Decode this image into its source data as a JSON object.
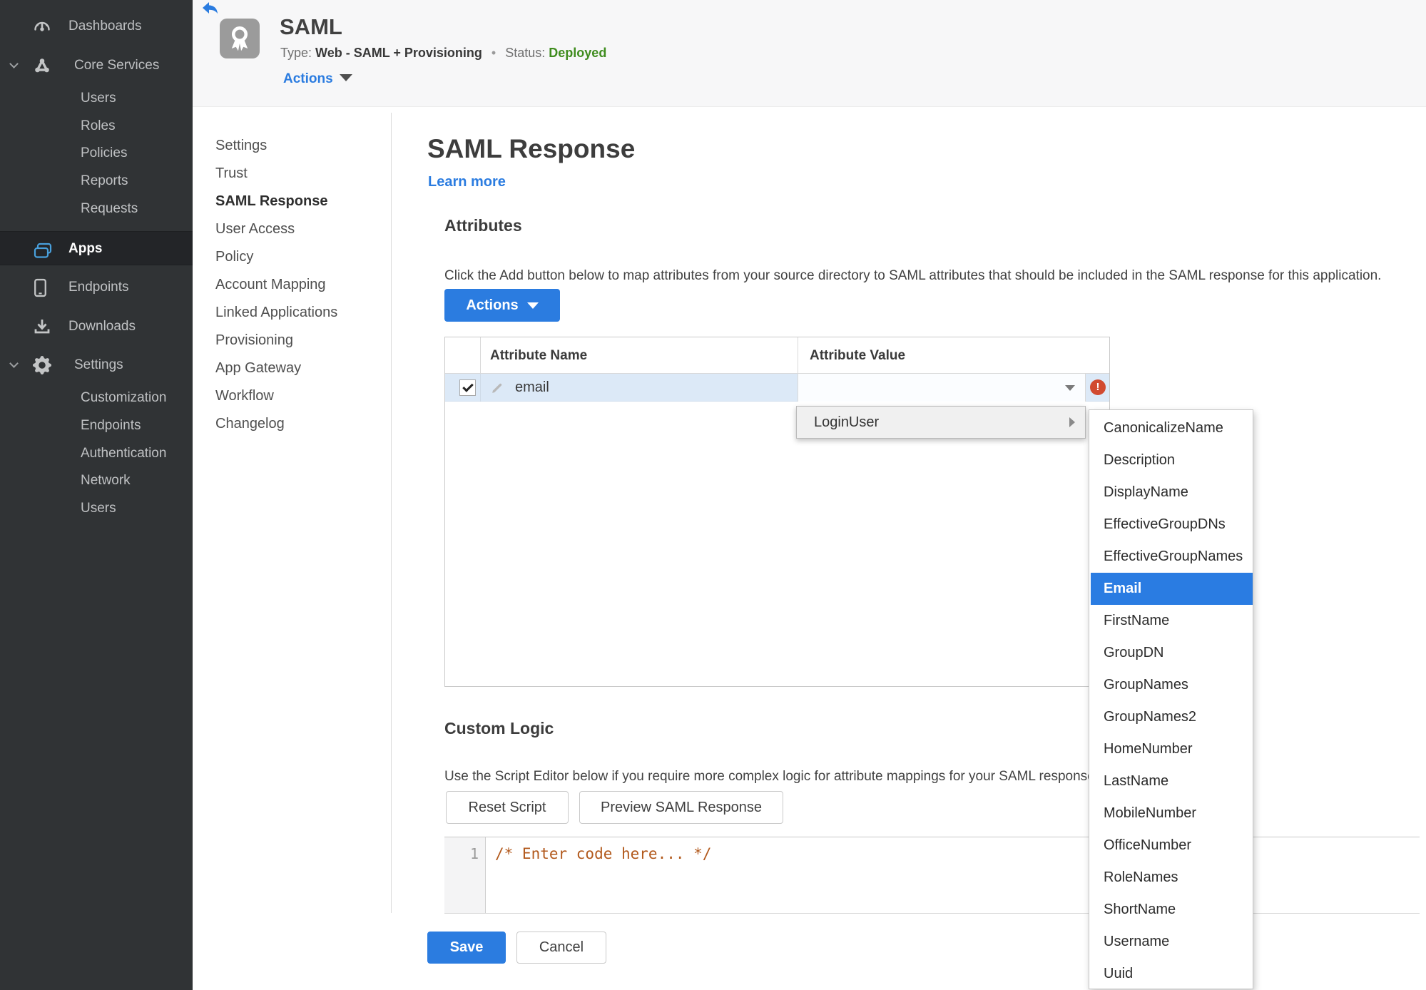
{
  "colors": {
    "accent_blue": "#2b7ce0",
    "menu_selected_blue": "#2a7ce2",
    "status_green": "#3f8c1e",
    "error_red": "#d14a30",
    "row_highlight": "#dce9f7",
    "code_text": "#b2591c",
    "sidebar_bg": "#303335",
    "apps_icon_blue": "#49a0dc"
  },
  "sidebar": {
    "items": [
      {
        "id": "dashboards",
        "label": "Dashboards",
        "icon": "gauge-icon",
        "level": 0
      },
      {
        "id": "core-services",
        "label": "Core Services",
        "icon": "network-icon",
        "level": 0,
        "expanded": true
      },
      {
        "id": "users",
        "label": "Users",
        "level": 1
      },
      {
        "id": "roles",
        "label": "Roles",
        "level": 1
      },
      {
        "id": "policies",
        "label": "Policies",
        "level": 1
      },
      {
        "id": "reports",
        "label": "Reports",
        "level": 1
      },
      {
        "id": "requests",
        "label": "Requests",
        "level": 1
      },
      {
        "id": "apps",
        "label": "Apps",
        "icon": "apps-icon",
        "level": 0,
        "active": true
      },
      {
        "id": "endpoints",
        "label": "Endpoints",
        "icon": "device-icon",
        "level": 0
      },
      {
        "id": "downloads",
        "label": "Downloads",
        "icon": "download-icon",
        "level": 0
      },
      {
        "id": "settings",
        "label": "Settings",
        "icon": "gear-icon",
        "level": 0,
        "expanded": true
      },
      {
        "id": "customization",
        "label": "Customization",
        "level": 1
      },
      {
        "id": "settings-endpoints",
        "label": "Endpoints",
        "level": 1
      },
      {
        "id": "authentication",
        "label": "Authentication",
        "level": 1
      },
      {
        "id": "network",
        "label": "Network",
        "level": 1
      },
      {
        "id": "settings-users",
        "label": "Users",
        "level": 1
      }
    ]
  },
  "header": {
    "title": "SAML",
    "type_label": "Type:",
    "type_value": "Web - SAML + Provisioning",
    "separator": "•",
    "status_label": "Status:",
    "status_value": "Deployed",
    "actions_label": "Actions"
  },
  "subnav": {
    "items": [
      {
        "label": "Settings"
      },
      {
        "label": "Trust"
      },
      {
        "label": "SAML Response",
        "active": true
      },
      {
        "label": "User Access"
      },
      {
        "label": "Policy"
      },
      {
        "label": "Account Mapping"
      },
      {
        "label": "Linked Applications"
      },
      {
        "label": "Provisioning"
      },
      {
        "label": "App Gateway"
      },
      {
        "label": "Workflow"
      },
      {
        "label": "Changelog"
      }
    ]
  },
  "main": {
    "title": "SAML Response",
    "learn_more": "Learn more",
    "attributes": {
      "heading": "Attributes",
      "description": "Click the Add button below to map attributes from your source directory to SAML attributes that should be included in the SAML response for this application.",
      "actions_button": "Actions",
      "table": {
        "columns": [
          "Attribute Name",
          "Attribute Value"
        ],
        "rows": [
          {
            "name": "email",
            "value": "",
            "checked": true,
            "error": true
          }
        ]
      }
    },
    "value_menu": {
      "label": "LoginUser",
      "selected": "Email",
      "options": [
        "CanonicalizeName",
        "Description",
        "DisplayName",
        "EffectiveGroupDNs",
        "EffectiveGroupNames",
        "Email",
        "FirstName",
        "GroupDN",
        "GroupNames",
        "GroupNames2",
        "HomeNumber",
        "LastName",
        "MobileNumber",
        "OfficeNumber",
        "RoleNames",
        "ShortName",
        "Username",
        "Uuid"
      ]
    },
    "custom_logic": {
      "heading": "Custom Logic",
      "description": "Use the Script Editor below if you require more complex logic for attribute mappings for your SAML response.",
      "reset_button": "Reset Script",
      "preview_button": "Preview SAML Response",
      "editor": {
        "line_number": "1",
        "code": "/* Enter code here... */"
      }
    },
    "save_button": "Save",
    "cancel_button": "Cancel"
  }
}
